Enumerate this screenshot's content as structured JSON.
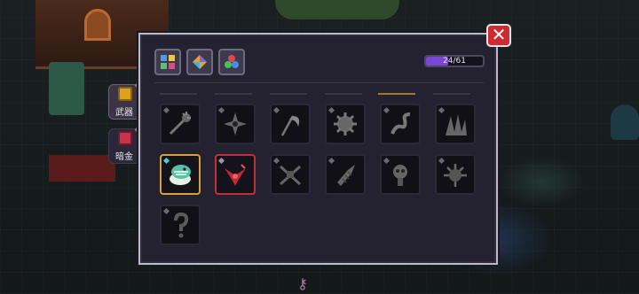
{
  "side_tabs": [
    {
      "label": "武器",
      "icon": "weapon-chest-icon",
      "active": true
    },
    {
      "label": "暗金",
      "icon": "dark-gold-icon",
      "active": false
    }
  ],
  "filters": [
    {
      "icon": "grid-filter-icon"
    },
    {
      "icon": "diamond-gem-icon"
    },
    {
      "icon": "tri-orb-icon"
    }
  ],
  "progress": {
    "label": "24/61",
    "current": 24,
    "total": 61
  },
  "close": {
    "label": "✕"
  },
  "weapons": [
    {
      "icon": "spiked-club-icon",
      "state": "locked"
    },
    {
      "icon": "shuriken-icon",
      "state": "locked"
    },
    {
      "icon": "scythe-icon",
      "state": "locked"
    },
    {
      "icon": "gear-bomb-icon",
      "state": "locked"
    },
    {
      "icon": "serpent-blade-icon",
      "state": "locked"
    },
    {
      "icon": "claw-spikes-icon",
      "state": "locked"
    },
    {
      "icon": "bone-dragon-icon",
      "state": "selected"
    },
    {
      "icon": "red-boomerang-icon",
      "state": "highlighted"
    },
    {
      "icon": "crossbow-icon",
      "state": "locked"
    },
    {
      "icon": "drill-lance-icon",
      "state": "locked"
    },
    {
      "icon": "skull-totem-icon",
      "state": "locked"
    },
    {
      "icon": "spiked-mace-icon",
      "state": "locked"
    },
    {
      "icon": "mystery-hook-icon",
      "state": "locked"
    }
  ],
  "colors": {
    "panel": "#242231",
    "gold_border": "#d4a13a",
    "red_border": "#c0303a",
    "progress_fill": "#7b45d6",
    "close_red": "#d02a30"
  }
}
